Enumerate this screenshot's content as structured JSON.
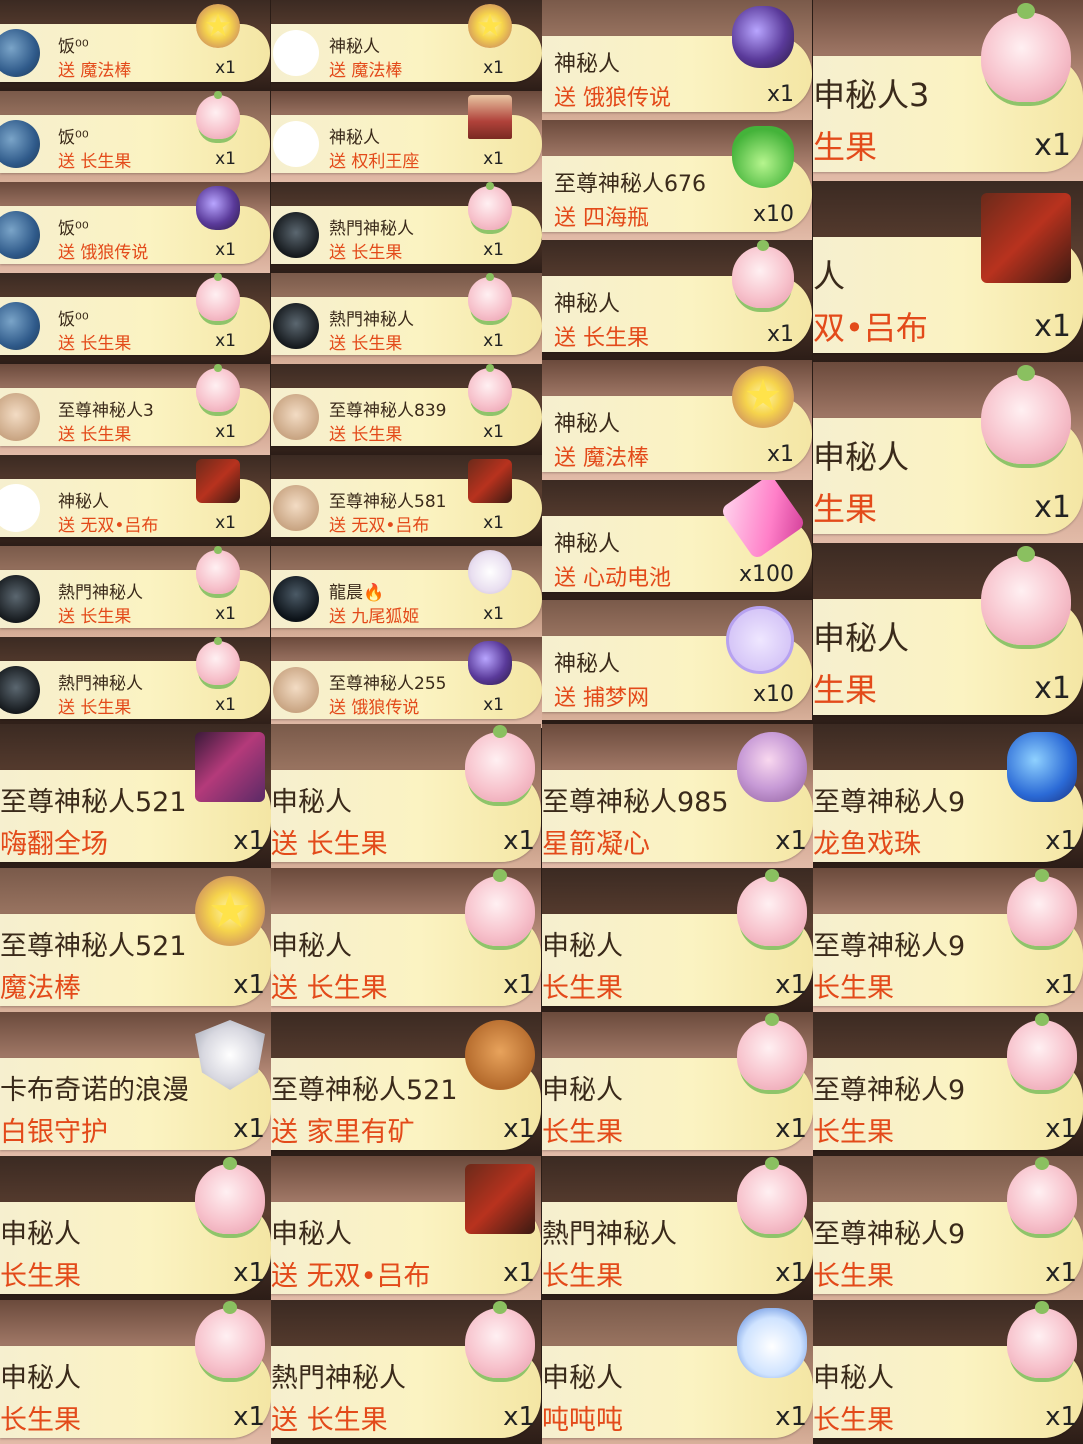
{
  "colors": {
    "banner": "#fbf3c2",
    "name": "#3a2a1a",
    "gift": "#e34a1a",
    "count": "#222222"
  },
  "col1": [
    {
      "name": "饭⁰⁰",
      "gift": "送 魔法棒",
      "count": "x1",
      "avatar": "sea-avatar",
      "icon": "magic-wand-icon"
    },
    {
      "name": "饭⁰⁰",
      "gift": "送 长生果",
      "count": "x1",
      "avatar": "sea-avatar",
      "icon": "peach-icon"
    },
    {
      "name": "饭⁰⁰",
      "gift": "送 饿狼传说",
      "count": "x1",
      "avatar": "sea-avatar",
      "icon": "orb-icon"
    },
    {
      "name": "饭⁰⁰",
      "gift": "送 长生果",
      "count": "x1",
      "avatar": "sea-avatar",
      "icon": "peach-icon"
    },
    {
      "name": "至尊神秘人3",
      "gift": "送 长生果",
      "count": "x1",
      "avatar": "mask-avatar",
      "icon": "peach-icon"
    },
    {
      "name": "神秘人",
      "gift": "送 无双•吕布",
      "count": "x1",
      "avatar": "hat-avatar",
      "icon": "warrior-icon"
    },
    {
      "name": "熱門神秘人",
      "gift": "送 长生果",
      "count": "x1",
      "avatar": "crow-avatar",
      "icon": "peach-icon"
    },
    {
      "name": "熱門神秘人",
      "gift": "送 长生果",
      "count": "x1",
      "avatar": "crow-avatar",
      "icon": "peach-icon"
    }
  ],
  "col2": [
    {
      "name": "神秘人",
      "gift": "送 魔法棒",
      "count": "x1",
      "avatar": "hat-avatar",
      "icon": "magic-wand-icon"
    },
    {
      "name": "神秘人",
      "gift": "送 权利王座",
      "count": "x1",
      "avatar": "hat-avatar",
      "icon": "throne-icon"
    },
    {
      "name": "熱門神秘人",
      "gift": "送 长生果",
      "count": "x1",
      "avatar": "crow-avatar",
      "icon": "peach-icon"
    },
    {
      "name": "熱門神秘人",
      "gift": "送 长生果",
      "count": "x1",
      "avatar": "crow-avatar",
      "icon": "peach-icon"
    },
    {
      "name": "至尊神秘人839",
      "gift": "送 长生果",
      "count": "x1",
      "avatar": "mask-avatar",
      "icon": "peach-icon"
    },
    {
      "name": "至尊神秘人581",
      "gift": "送 无双•吕布",
      "count": "x1",
      "avatar": "mask-avatar",
      "icon": "warrior-icon"
    },
    {
      "name": "龍晨🔥",
      "gift": "送 九尾狐姬",
      "count": "x1",
      "avatar": "hood-avatar",
      "icon": "fox-icon"
    },
    {
      "name": "至尊神秘人255",
      "gift": "送 饿狼传说",
      "count": "x1",
      "avatar": "mask-avatar",
      "icon": "orb-icon"
    }
  ],
  "col3": [
    {
      "name": "神秘人",
      "gift": "送 饿狼传说",
      "count": "x1",
      "icon": "orb-icon"
    },
    {
      "name": "至尊神秘人676",
      "gift": "送 四海瓶",
      "count": "x10",
      "icon": "vase-icon"
    },
    {
      "name": "神秘人",
      "gift": "送 长生果",
      "count": "x1",
      "icon": "peach-icon"
    },
    {
      "name": "神秘人",
      "gift": "送 魔法棒",
      "count": "x1",
      "icon": "magic-wand-icon"
    },
    {
      "name": "神秘人",
      "gift": "送 心动电池",
      "count": "x100",
      "icon": "battery-icon"
    },
    {
      "name": "神秘人",
      "gift": "送 捕梦网",
      "count": "x10",
      "icon": "dreamcatcher-icon"
    }
  ],
  "col4": [
    {
      "name": "申秘人3",
      "gift": "生果",
      "count": "x1",
      "icon": "peach-icon"
    },
    {
      "name": "人",
      "gift": "双•吕布",
      "count": "x1",
      "icon": "warrior-icon"
    },
    {
      "name": "申秘人",
      "gift": "生果",
      "count": "x1",
      "icon": "peach-icon"
    },
    {
      "name": "申秘人",
      "gift": "生果",
      "count": "x1",
      "icon": "peach-icon"
    }
  ],
  "grid": [
    [
      {
        "name": "至尊神秘人521",
        "gift": "嗨翻全场",
        "count": "x1",
        "icon": "dancer-icon"
      },
      {
        "name": "申秘人",
        "gift": "送 长生果",
        "count": "x1",
        "icon": "peach-icon"
      },
      {
        "name": "至尊神秘人985",
        "gift": "星箭凝心",
        "count": "x1",
        "icon": "heart-icon"
      },
      {
        "name": "至尊神秘人9",
        "gift": "龙鱼戏珠",
        "count": "x1",
        "icon": "dragon-icon"
      }
    ],
    [
      {
        "name": "至尊神秘人521",
        "gift": "魔法棒",
        "count": "x1",
        "icon": "magic-wand-icon"
      },
      {
        "name": "申秘人",
        "gift": "送 长生果",
        "count": "x1",
        "icon": "peach-icon"
      },
      {
        "name": "申秘人",
        "gift": "长生果",
        "count": "x1",
        "icon": "peach-icon"
      },
      {
        "name": "至尊神秘人9",
        "gift": "长生果",
        "count": "x1",
        "icon": "peach-icon"
      }
    ],
    [
      {
        "name": "卡布奇诺的浪漫",
        "gift": "白银守护",
        "count": "x1",
        "icon": "shield-icon"
      },
      {
        "name": "至尊神秘人521",
        "gift": "送 家里有矿",
        "count": "x1",
        "icon": "bear-icon"
      },
      {
        "name": "申秘人",
        "gift": "长生果",
        "count": "x1",
        "icon": "peach-icon"
      },
      {
        "name": "至尊神秘人9",
        "gift": "长生果",
        "count": "x1",
        "icon": "peach-icon"
      }
    ],
    [
      {
        "name": "申秘人",
        "gift": "长生果",
        "count": "x1",
        "icon": "peach-icon"
      },
      {
        "name": "申秘人",
        "gift": "送 无双•吕布",
        "count": "x1",
        "icon": "warrior-icon"
      },
      {
        "name": "熱門神秘人",
        "gift": "长生果",
        "count": "x1",
        "icon": "peach-icon"
      },
      {
        "name": "至尊神秘人9",
        "gift": "长生果",
        "count": "x1",
        "icon": "peach-icon"
      }
    ],
    [
      {
        "name": "申秘人",
        "gift": "长生果",
        "count": "x1",
        "icon": "peach-icon"
      },
      {
        "name": "熱門神秘人",
        "gift": "送 长生果",
        "count": "x1",
        "icon": "peach-icon"
      },
      {
        "name": "申秘人",
        "gift": "吨吨吨",
        "count": "x1",
        "icon": "penguin-icon"
      },
      {
        "name": "申秘人",
        "gift": "长生果",
        "count": "x1",
        "icon": "peach-icon"
      }
    ]
  ]
}
